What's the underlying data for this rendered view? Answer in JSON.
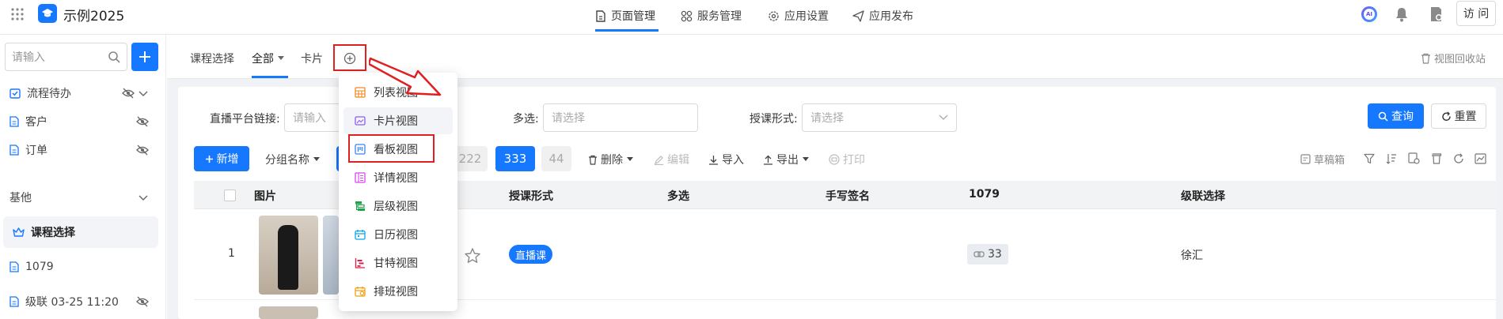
{
  "topbar": {
    "app_title": "示例2025",
    "nav": [
      {
        "label": "页面管理",
        "icon": "document-icon",
        "active": true
      },
      {
        "label": "服务管理",
        "icon": "apps-icon"
      },
      {
        "label": "应用设置",
        "icon": "gear-icon"
      },
      {
        "label": "应用发布",
        "icon": "send-icon"
      }
    ],
    "visit_label": "访 问"
  },
  "sidebar": {
    "search_placeholder": "请输入",
    "items": [
      {
        "label": "流程待办",
        "icon": "check-square-icon",
        "hidden": true,
        "chevron": true
      },
      {
        "label": "客户",
        "icon": "file-icon",
        "hidden": true
      },
      {
        "label": "订单",
        "icon": "file-icon",
        "hidden": true
      },
      {
        "label": "基他",
        "group": true
      },
      {
        "label": "课程选择",
        "icon": "crown-icon",
        "active": true
      },
      {
        "label": "1079",
        "icon": "file-icon"
      },
      {
        "label": "级联 03-25 11:20",
        "icon": "file-icon",
        "hidden": true
      }
    ]
  },
  "view_tabs": [
    {
      "label": "课程选择"
    },
    {
      "label": "全部",
      "active": true,
      "dropdown": true
    },
    {
      "label": "卡片"
    }
  ],
  "recycle_label": "视图回收站",
  "filters": {
    "f1_label": "直播平台链接:",
    "f1_placeholder": "请输入",
    "f2_label": "多选:",
    "f2_placeholder": "请选择",
    "f3_label": "授课形式:",
    "f3_placeholder": "请选择",
    "query_label": "查询",
    "reset_label": "重置"
  },
  "toolbar": {
    "new_label": "新增",
    "group_label": "分组名称",
    "chips": [
      "222",
      "333",
      "44"
    ],
    "delete_label": "删除",
    "edit_label": "编辑",
    "import_label": "导入",
    "export_label": "导出",
    "print_label": "打印",
    "draft_label": "草稿箱"
  },
  "table": {
    "headers": [
      "图片",
      "授课形式",
      "多选",
      "手写签名",
      "1079",
      "级联选择"
    ],
    "rows": [
      {
        "index": "1",
        "course_type": "直播课",
        "number": "33",
        "cascade": "徐汇"
      }
    ]
  },
  "view_menu": [
    {
      "label": "列表视图",
      "icon": "table-icon",
      "color": "#f08a24"
    },
    {
      "label": "卡片视图",
      "icon": "card-icon",
      "color": "#8b5cf6",
      "hover": true
    },
    {
      "label": "看板视图",
      "icon": "kanban-icon",
      "color": "#3b82f6",
      "highlighted": true
    },
    {
      "label": "详情视图",
      "icon": "detail-icon",
      "color": "#d946ef"
    },
    {
      "label": "层级视图",
      "icon": "hierarchy-icon",
      "color": "#22a34a"
    },
    {
      "label": "日历视图",
      "icon": "calendar-icon",
      "color": "#0ea5e9"
    },
    {
      "label": "甘特视图",
      "icon": "gantt-icon",
      "color": "#e11d48"
    },
    {
      "label": "排班视图",
      "icon": "schedule-icon",
      "color": "#f59e0b"
    }
  ],
  "colors": {
    "primary": "#1677ff",
    "annotation": "#e02020"
  }
}
